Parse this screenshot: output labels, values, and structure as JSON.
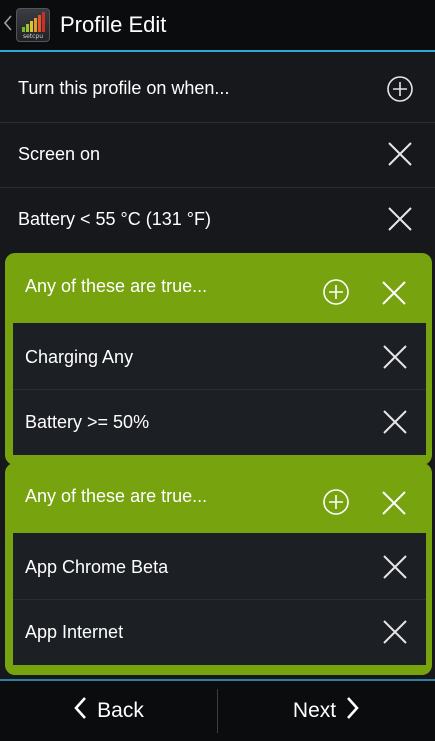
{
  "action_bar": {
    "title": "Profile Edit",
    "app_icon_caption": "setcpu",
    "icons": {
      "up": "chevron-left-icon",
      "app": "setcpu-app-icon"
    }
  },
  "conditions": {
    "header_label": "Turn this profile on when...",
    "header_icon": "add-circle-icon",
    "items": [
      {
        "label": "Screen on",
        "icon": "close-icon"
      },
      {
        "label": "Battery < 55 °C (131 °F)",
        "icon": "close-icon"
      }
    ]
  },
  "groups": [
    {
      "header_label": "Any of these are true...",
      "items": [
        {
          "label": "Charging Any"
        },
        {
          "label": "Battery >= 50%"
        }
      ]
    },
    {
      "header_label": "Any of these are true...",
      "items": [
        {
          "label": "App Chrome Beta"
        },
        {
          "label": "App Internet"
        }
      ]
    }
  ],
  "bottom_bar": {
    "back_label": "Back",
    "next_label": "Next"
  },
  "colors": {
    "accent_blue": "#33a6d8",
    "group_green": "#77a30f",
    "background": "#16181c",
    "action_bar": "#0b0c0e"
  }
}
